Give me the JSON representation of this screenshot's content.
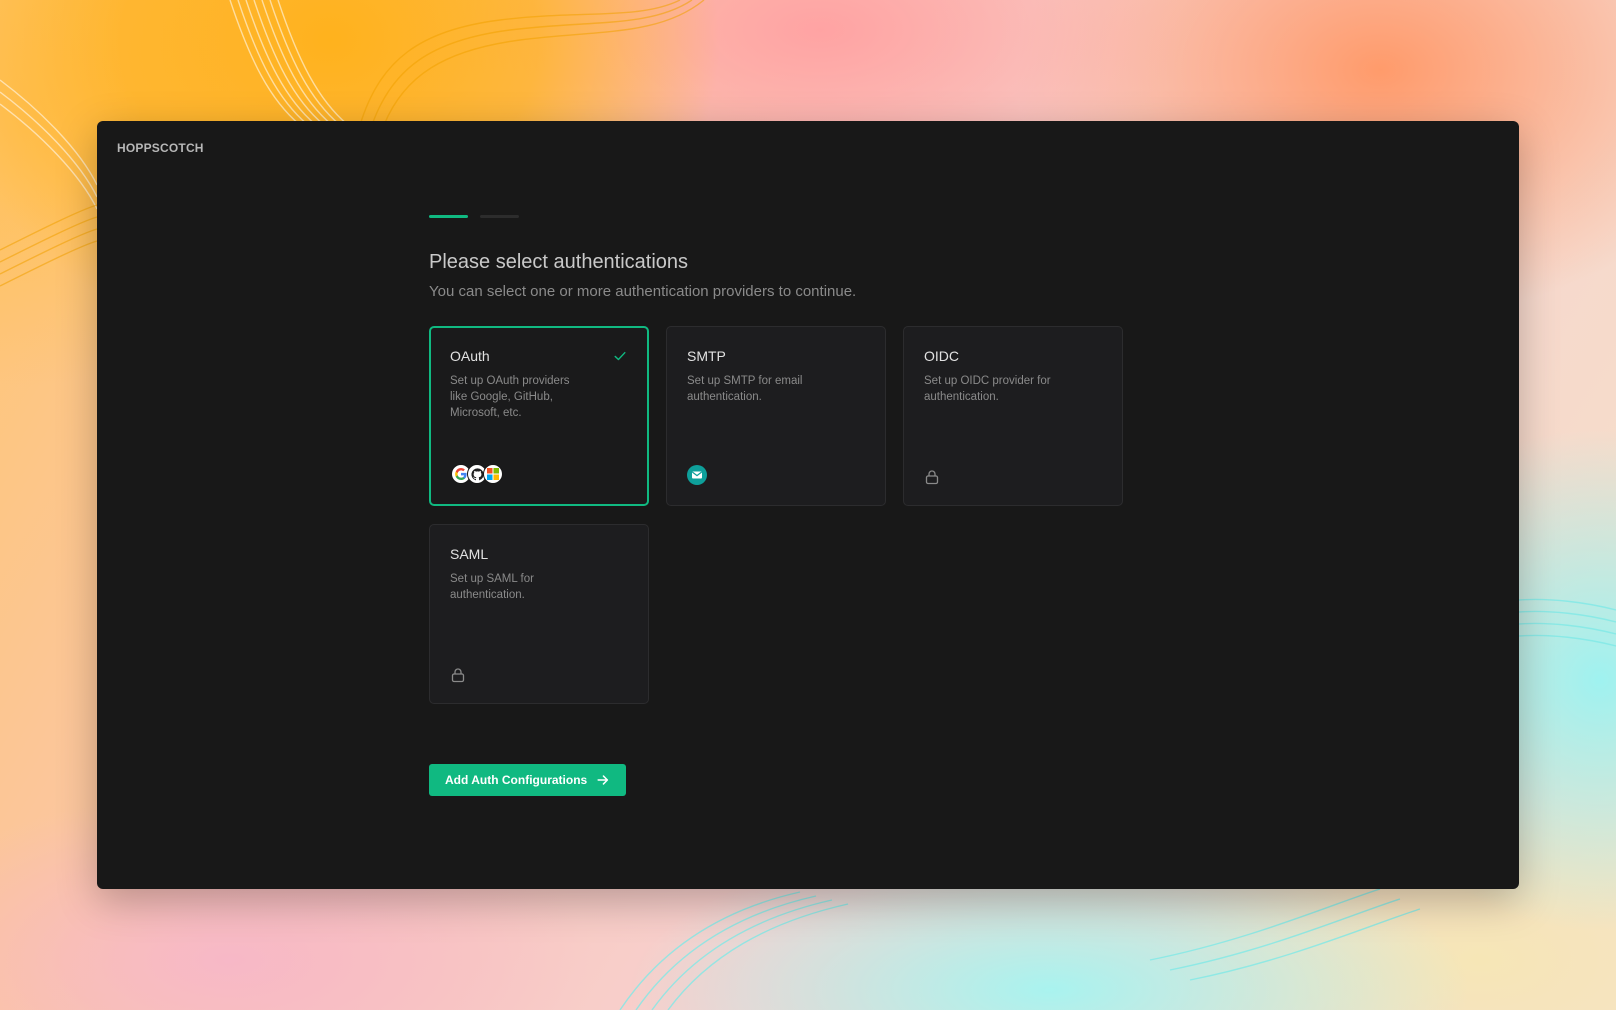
{
  "app": {
    "brand": "HOPPSCOTCH"
  },
  "steps": {
    "current": 1,
    "total": 2
  },
  "header": {
    "title": "Please select authentications",
    "subtitle": "You can select one or more authentication providers to continue."
  },
  "providers": [
    {
      "title": "OAuth",
      "description": "Set up OAuth providers like Google, GitHub, Microsoft, etc.",
      "selected": true,
      "icons": [
        "google-icon",
        "github-icon",
        "microsoft-icon"
      ]
    },
    {
      "title": "SMTP",
      "description": "Set up SMTP for email authentication.",
      "selected": false,
      "icons": [
        "mail-icon"
      ]
    },
    {
      "title": "OIDC",
      "description": "Set up OIDC provider for authentication.",
      "selected": false,
      "icons": [
        "lock-icon"
      ]
    },
    {
      "title": "SAML",
      "description": "Set up SAML for authentication.",
      "selected": false,
      "icons": [
        "lock-icon"
      ]
    }
  ],
  "actions": {
    "primary_label": "Add Auth Configurations",
    "primary_icon": "arrow-right-icon"
  },
  "colors": {
    "accent": "#10b981",
    "window_bg": "#181818",
    "card_bg": "#1d1d1f"
  }
}
